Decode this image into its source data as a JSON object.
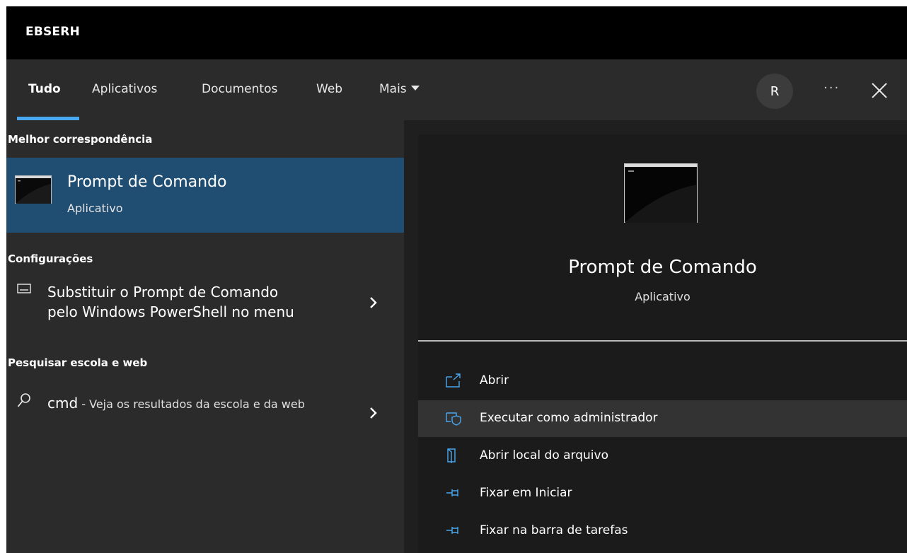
{
  "window": {
    "title": "EBSERH"
  },
  "tabs": {
    "items": [
      {
        "label": "Tudo"
      },
      {
        "label": "Aplicativos"
      },
      {
        "label": "Documentos"
      },
      {
        "label": "Web"
      },
      {
        "label": "Mais"
      }
    ],
    "active": "Tudo"
  },
  "header_actions": {
    "avatar_initial": "R",
    "more_label": "···",
    "accent": "#4aa8f0"
  },
  "left": {
    "best_match": {
      "heading": "Melhor correspondência",
      "name": "Prompt de Comando",
      "type": "Aplicativo",
      "icon": "cmd-icon",
      "highlight": "#204d72"
    },
    "settings": {
      "heading": "Configurações",
      "item_line1": "Substituir o Prompt de Comando",
      "item_line2": "pelo Windows PowerShell no menu",
      "icon": "keyboard-icon"
    },
    "web": {
      "heading": "Pesquisar escola e web",
      "query": "cmd",
      "suffix": " - Veja os resultados da escola e da web",
      "icon": "search-icon"
    }
  },
  "right": {
    "name": "Prompt de Comando",
    "type": "Aplicativo",
    "actions": [
      {
        "label": "Abrir",
        "icon": "open-icon"
      },
      {
        "label": "Executar como administrador",
        "icon": "run-as-admin-icon"
      },
      {
        "label": "Abrir local do arquivo",
        "icon": "file-location-icon"
      },
      {
        "label": "Fixar em Iniciar",
        "icon": "pin-icon"
      },
      {
        "label": "Fixar na barra de tarefas",
        "icon": "pin-icon"
      }
    ]
  }
}
